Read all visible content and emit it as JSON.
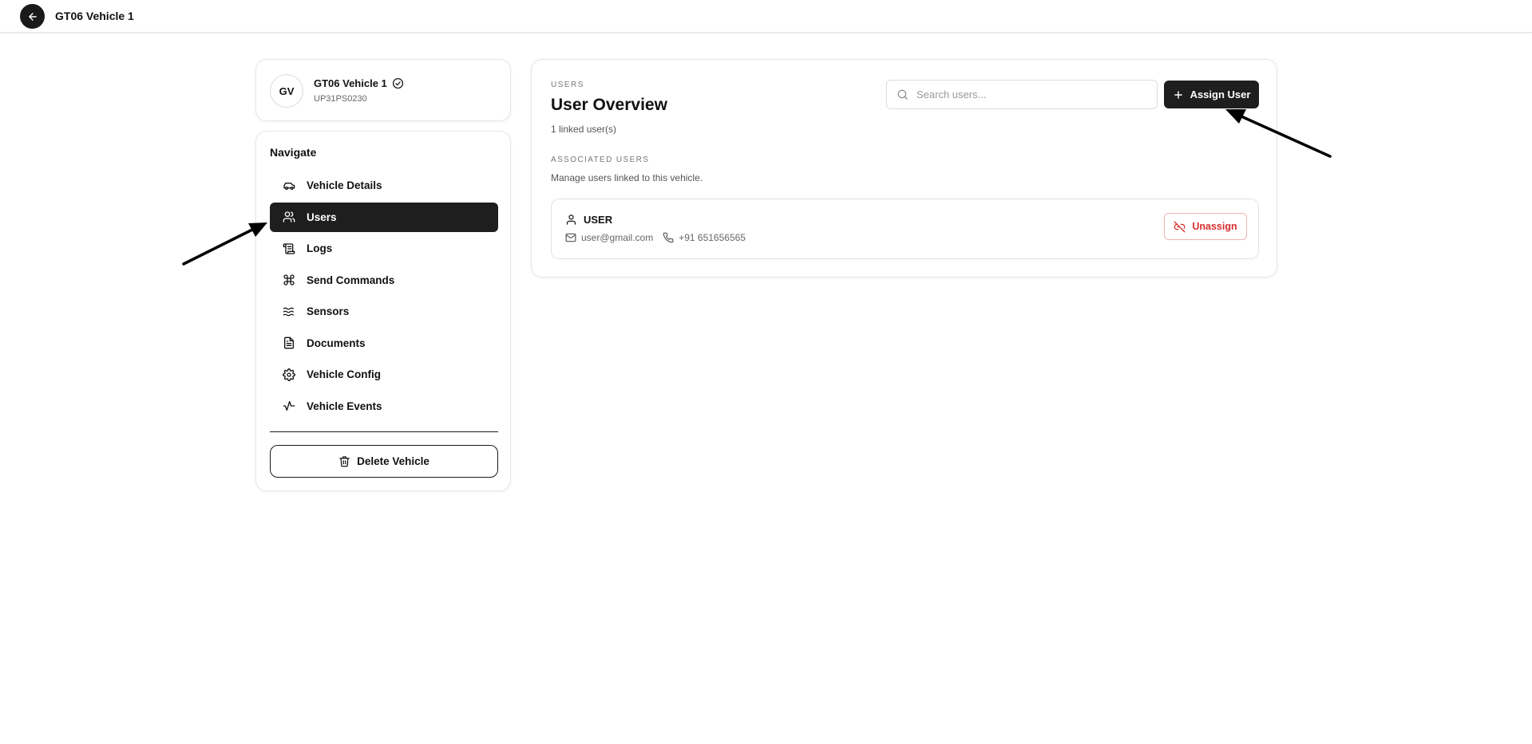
{
  "topbar": {
    "title": "GT06 Vehicle 1",
    "back_icon": "arrow-left-icon"
  },
  "vehicle": {
    "initials": "GV",
    "name": "GT06 Vehicle 1",
    "plate": "UP31PS0230",
    "verified_icon": "check-circle-icon"
  },
  "nav": {
    "heading": "Navigate",
    "items": [
      {
        "label": "Vehicle Details",
        "icon": "car-icon",
        "active": false
      },
      {
        "label": "Users",
        "icon": "users-icon",
        "active": true
      },
      {
        "label": "Logs",
        "icon": "scroll-icon",
        "active": false
      },
      {
        "label": "Send Commands",
        "icon": "command-icon",
        "active": false
      },
      {
        "label": "Sensors",
        "icon": "waves-icon",
        "active": false
      },
      {
        "label": "Documents",
        "icon": "file-text-icon",
        "active": false
      },
      {
        "label": "Vehicle Config",
        "icon": "gear-icon",
        "active": false
      },
      {
        "label": "Vehicle Events",
        "icon": "activity-icon",
        "active": false
      }
    ],
    "delete_label": "Delete Vehicle",
    "delete_icon": "trash-icon"
  },
  "main": {
    "eyebrow": "USERS",
    "title": "User Overview",
    "linked_count": "1 linked user(s)",
    "search_placeholder": "Search users...",
    "search_value": "",
    "assign_label": "Assign User",
    "section_label": "ASSOCIATED USERS",
    "section_desc": "Manage users linked to this vehicle.",
    "users": [
      {
        "name": "USER",
        "email": "user@gmail.com",
        "phone": "+91 651656565",
        "unassign_label": "Unassign"
      }
    ]
  },
  "colors": {
    "accent_dark": "#1e1e1e",
    "danger": "#d92d2d",
    "danger_border": "#f0b4b4",
    "muted_text": "#666666"
  }
}
